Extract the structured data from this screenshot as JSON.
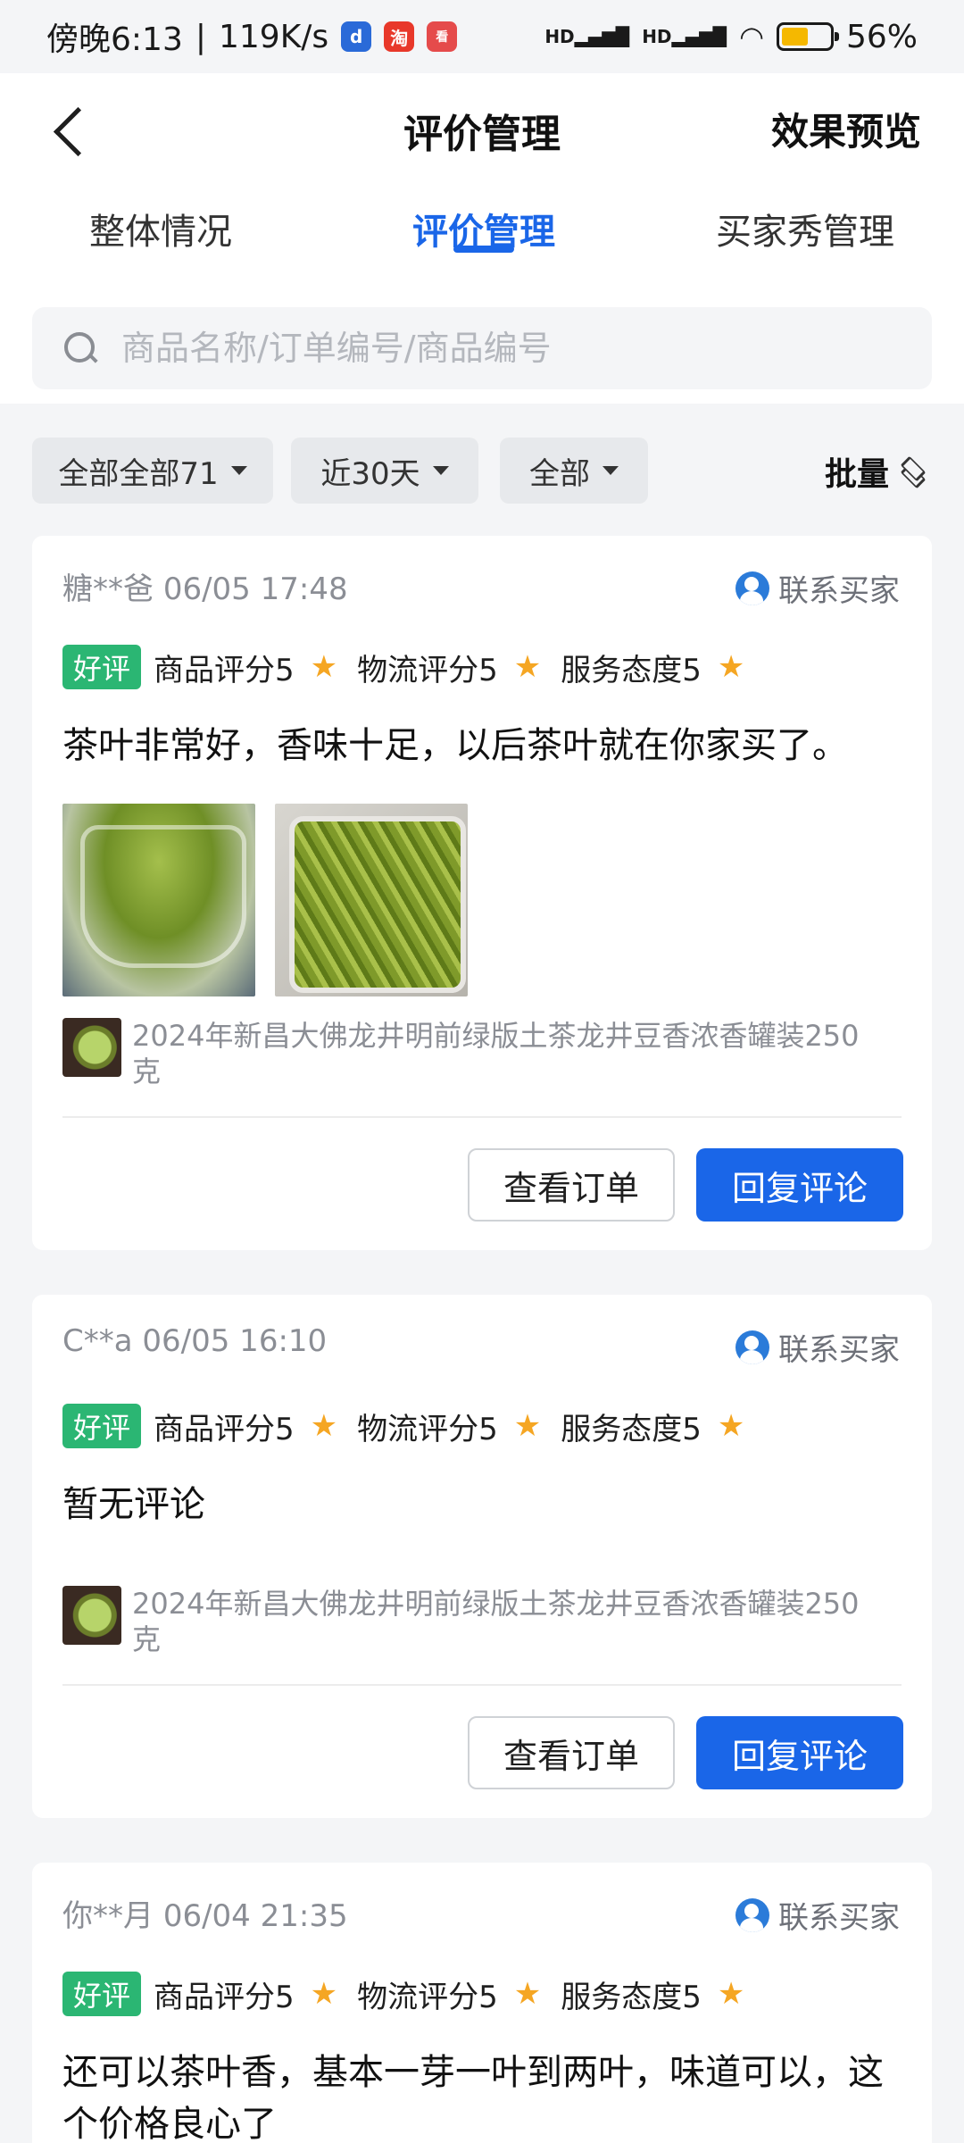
{
  "status_bar": {
    "time": "傍晚6:13",
    "net_speed": "119K/s",
    "battery": "56%",
    "battery_level": 0.56
  },
  "header": {
    "title": "评价管理",
    "preview": "效果预览"
  },
  "tabs": [
    {
      "label": "整体情况",
      "active": false
    },
    {
      "label": "评价管理",
      "active": true
    },
    {
      "label": "买家秀管理",
      "active": false
    }
  ],
  "search": {
    "placeholder": "商品名称/订单编号/商品编号"
  },
  "filters": {
    "type": "全部全部71",
    "period": "近30天",
    "status": "全部",
    "batch": "批量"
  },
  "reviews": [
    {
      "user": "糖**爸",
      "datetime": "06/05 17:48",
      "contact": "联系买家",
      "badge": "好评",
      "product_score": "商品评分5",
      "logistics_score": "物流评分5",
      "service_score": "服务态度5",
      "comment": "茶叶非常好，香味十足，以后茶叶就在你家买了。",
      "product": "2024年新昌大佛龙井明前绿版土茶龙井豆香浓香罐装250克",
      "view_order": "查看订单",
      "reply": "回复评论"
    },
    {
      "user": "C**a",
      "datetime": "06/05 16:10",
      "contact": "联系买家",
      "badge": "好评",
      "product_score": "商品评分5",
      "logistics_score": "物流评分5",
      "service_score": "服务态度5",
      "comment": "暂无评论",
      "product": "2024年新昌大佛龙井明前绿版土茶龙井豆香浓香罐装250克",
      "view_order": "查看订单",
      "reply": "回复评论"
    },
    {
      "user": "你**月",
      "datetime": "06/04 21:35",
      "contact": "联系买家",
      "badge": "好评",
      "product_score": "商品评分5",
      "logistics_score": "物流评分5",
      "service_score": "服务态度5",
      "comment": "还可以茶叶香，基本一芽一叶到两叶，味道可以，这个价格良心了"
    }
  ]
}
